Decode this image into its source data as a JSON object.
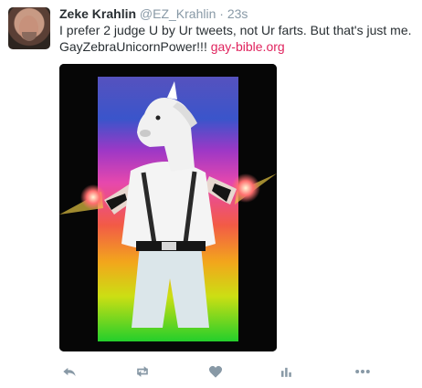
{
  "tweet": {
    "name": "Zeke Krahlin",
    "handle": "@EZ_Krahlin",
    "separator": "·",
    "time": "23s",
    "text": "I prefer 2 judge U by Ur tweets, not Ur farts. But that's just me.\nGayZebraUnicornPower!!! ",
    "link_text": "gay-bible.org"
  },
  "actions": [
    {
      "icon": "reply-icon"
    },
    {
      "icon": "retweet-icon"
    },
    {
      "icon": "like-icon"
    },
    {
      "icon": "analytics-icon"
    },
    {
      "icon": "more-icon"
    }
  ],
  "colors": {
    "link": "#e0245e",
    "icon": "#8899a6",
    "name": "#292f33"
  }
}
